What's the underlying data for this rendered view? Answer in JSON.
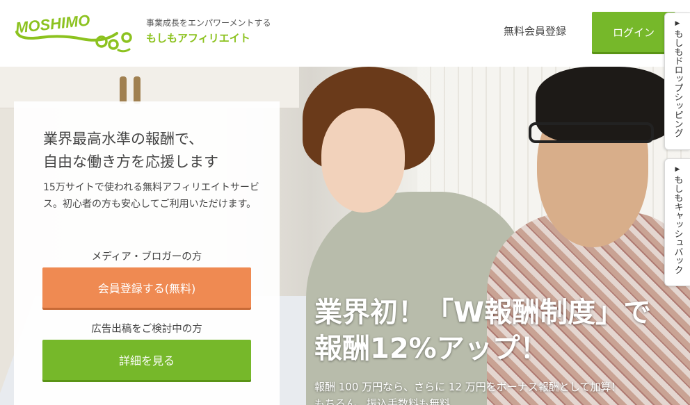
{
  "header": {
    "logo_text": "MOSHIMO",
    "tagline": "事業成長をエンパワーメントする",
    "brand": "もしもアフィリエイト",
    "register_link": "無料会員登録",
    "login_button": "ログイン"
  },
  "card": {
    "headline_1": "業界最高水準の報酬で、",
    "headline_2": "自由な働き方を応援します",
    "description": "15万サイトで使われる無料アフィリエイトサービス。初心者の方も安心してご利用いただけます。",
    "media_label": "メディア・ブロガーの方",
    "register_button": "会員登録する(無料)",
    "advertiser_label": "広告出稿をご検討中の方",
    "detail_button": "詳細を見る"
  },
  "promo": {
    "title_1": "業界初！「W報酬制度」で",
    "title_2": "報酬12%アップ！",
    "sub_1": "報酬 100 万円なら、さらに 12 万円をボーナス報酬として加算！",
    "sub_2": "もちろん、振込手数料も無料"
  },
  "side_tabs": [
    {
      "arrow": "▶",
      "label": "もしもドロップシッピング"
    },
    {
      "arrow": "▶",
      "label": "もしもキャッシュバック"
    }
  ],
  "colors": {
    "brand_green": "#76b82a",
    "logo_green": "#8cc21f",
    "orange": "#ef8a52"
  }
}
